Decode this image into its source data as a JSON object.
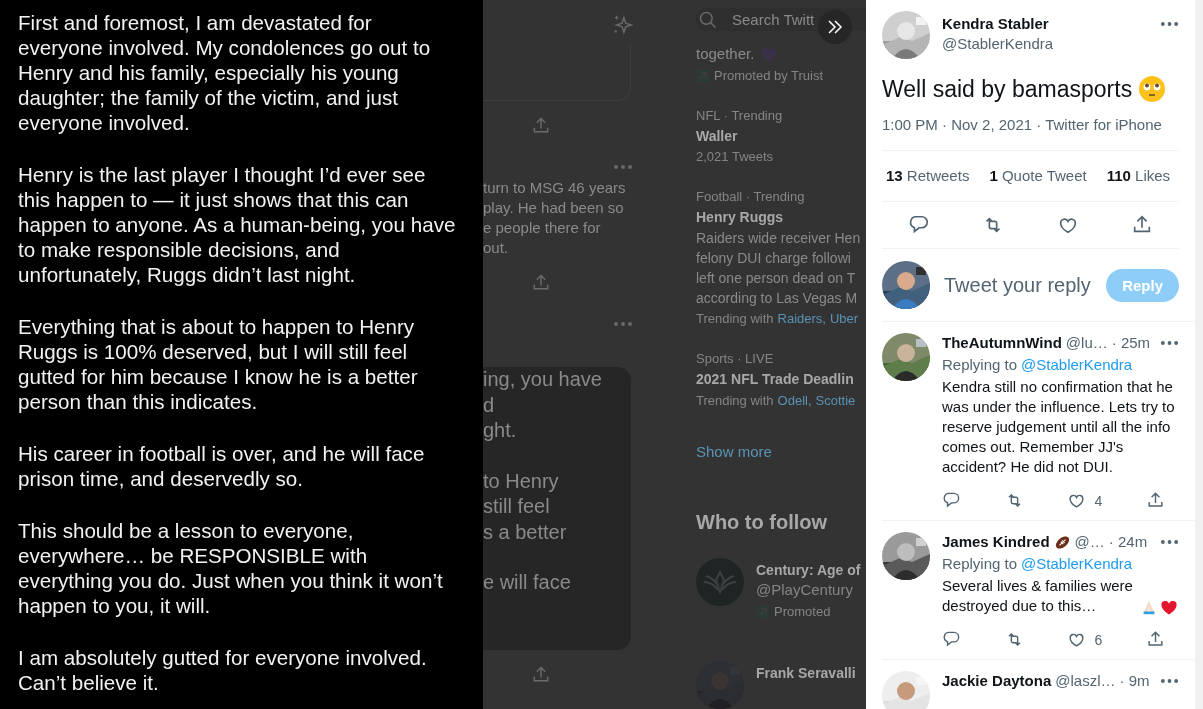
{
  "story": {
    "paragraphs": [
      "First and foremost, I am devastated for everyone involved. My condolences go out to Henry and his family, especially his young daughter; the family of the victim, and just everyone involved.",
      "Henry is the last player I thought I’d ever see this happen to — it just shows that this can happen to anyone. As a human-being, you have to make responsible decisions, and unfortunately, Ruggs didn’t last night.",
      "Everything that is about to happen to Henry Ruggs is 100% deserved, but I will still feel gutted for him because I know he is a better person than this indicates.",
      "His career in football is over, and he will face prison time, and deservedly so.",
      "This should be a lesson to everyone, everywhere… be RESPONSIBLE with everything you do. Just when you think it won’t happen to you, it will.",
      "I am absolutely gutted for everyone involved. Can’t believe it."
    ]
  },
  "background_feed": {
    "items": [
      {
        "kind": "sparkle"
      },
      {
        "kind": "card_end"
      },
      {
        "kind": "share"
      },
      {
        "kind": "more"
      },
      {
        "kind": "text",
        "lines": [
          "turn to MSG 46 years",
          "play. He had been so",
          "e people there for",
          "out."
        ]
      },
      {
        "kind": "share"
      },
      {
        "kind": "more"
      },
      {
        "kind": "image_card",
        "groups": [
          [
            "ing, you have",
            "d",
            "ght."
          ],
          [
            "to Henry",
            "still feel",
            "s a better"
          ],
          [
            "e will face"
          ]
        ]
      },
      {
        "kind": "share"
      }
    ]
  },
  "background_sidebar": {
    "search": {
      "placeholder": "Search Twitt"
    },
    "items": [
      {
        "kind": "ad",
        "text": "together.",
        "promoted": "Promoted by Truist"
      },
      {
        "kind": "trend",
        "context": "NFL · Trending",
        "title": "Waller",
        "meta": "2,021 Tweets"
      },
      {
        "kind": "trend",
        "context": "Football · Trending",
        "title": "Henry Ruggs",
        "lines": [
          "Raiders wide receiver Hen",
          "felony DUI charge followi",
          "left one person dead on T",
          "according to Las Vegas M"
        ],
        "trending_with": {
          "label": "Trending with",
          "links": [
            "Raiders,",
            "Uber"
          ]
        }
      },
      {
        "kind": "trend",
        "context": "Sports · LIVE",
        "title": "2021 NFL Trade Deadlin",
        "trending_with": {
          "label": "Trending with",
          "links": [
            "Odell,",
            "Scottie"
          ]
        }
      }
    ],
    "show_more": "Show more",
    "who_to_follow": {
      "title": "Who to follow",
      "accounts": [
        {
          "name": "Century: Age of",
          "handle": "@PlayCentury",
          "promoted": "Promoted"
        },
        {
          "name": "Frank Seravalli"
        }
      ]
    }
  },
  "tweet": {
    "author": "Kendra Stabler",
    "handle": "@StablerKendra",
    "text": "Well said by bamasports",
    "timestamp": "1:00 PM · Nov 2, 2021 · Twitter for iPhone",
    "stats": [
      {
        "count": "13",
        "label": "Retweets"
      },
      {
        "count": "1",
        "label": "Quote Tweet"
      },
      {
        "count": "110",
        "label": "Likes"
      }
    ]
  },
  "composer": {
    "placeholder": "Tweet your reply",
    "button": "Reply",
    "disabled": true
  },
  "replies": [
    {
      "name": "TheAutumnWind",
      "badge": false,
      "handle": "@lu…",
      "time": "· 25m",
      "replying_label": "Replying to",
      "replying_to": "@StablerKendra",
      "text": "Kendra still no confirmation that he was under the influence. Lets try to reserve judgement until all the info comes out. Remember JJ's accident? He did not DUI.",
      "emoji": false,
      "likes": "4"
    },
    {
      "name": "James Kindred",
      "badge": true,
      "handle": "@…",
      "time": "· 24m",
      "replying_label": "Replying to",
      "replying_to": "@StablerKendra",
      "text": "Several lives & families were destroyed due to this…",
      "emoji": true,
      "likes": "6"
    },
    {
      "name": "Jackie Daytona",
      "badge": false,
      "handle": "@laszl…",
      "time": "· 9m"
    }
  ]
}
